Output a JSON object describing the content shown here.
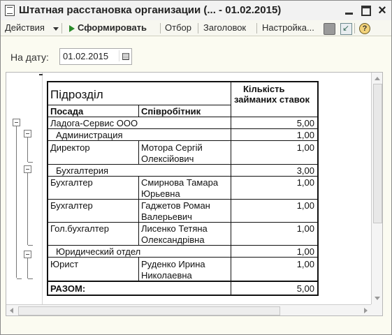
{
  "window": {
    "title": "Штатная расстановка организации (... - 01.02.2015)"
  },
  "toolbar": {
    "actions_label": "Действия",
    "generate_label": "Сформировать",
    "selection_label": "Отбор",
    "header_label": "Заголовок",
    "settings_label": "Настройка...",
    "help_label": "?"
  },
  "date": {
    "label": "На дату:",
    "value": "01.02.2015"
  },
  "report": {
    "headers": {
      "division": "Підрозділ",
      "rates_line1": "Кількість",
      "rates_line2": "займаних ставок",
      "position": "Посада",
      "employee": "Співробітник"
    },
    "rows": {
      "org": {
        "name": "Ладога-Сервис ООО",
        "value": "5,00"
      },
      "admin": {
        "name": "Администрация",
        "value": "1,00"
      },
      "director": {
        "position": "Директор",
        "employee_line1": "Мотора Сергій",
        "employee_line2": "Олексійович",
        "value": "1,00"
      },
      "accounting": {
        "name": "Бухгалтерия",
        "value": "3,00"
      },
      "acc1": {
        "position": "Бухгалтер",
        "employee_line1": "Смирнова Тамара",
        "employee_line2": "Юрьевна",
        "value": "1,00"
      },
      "acc2": {
        "position": "Бухгалтер",
        "employee_line1": "Гаджетов Роман",
        "employee_line2": "Валерьевич",
        "value": "1,00"
      },
      "chief": {
        "position": "Гол.бухгалтер",
        "employee_line1": "Лисенко Тетяна",
        "employee_line2": "Олександрівна",
        "value": "1,00"
      },
      "legal": {
        "name": "Юридический отдел",
        "value": "1,00"
      },
      "lawyer": {
        "position": "Юрист",
        "employee_line1": "Руденко Ирина",
        "employee_line2": "Николаевна",
        "value": "1,00"
      },
      "total": {
        "label": "РАЗОМ:",
        "value": "5,00"
      }
    }
  },
  "icons": {
    "app": "spreadsheet-icon",
    "generate": "play-icon",
    "print": "printer-icon",
    "export": "export-icon",
    "help": "help-icon",
    "calendar": "calendar-icon"
  }
}
